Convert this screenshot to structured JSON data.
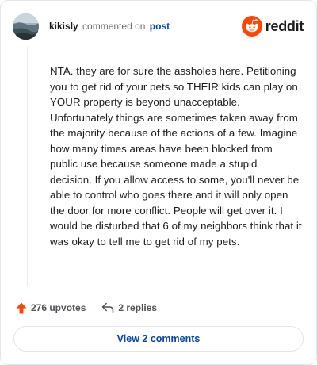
{
  "header": {
    "username": "kikisly",
    "verb": "commented on",
    "post_link": "post",
    "brand": "reddit",
    "logo_icon": "reddit-alien-icon",
    "avatar_icon": "user-avatar-image"
  },
  "comment": {
    "text": "NTA. they are for sure the assholes here. Petitioning you to get rid of your pets so THEIR kids can play on YOUR property is beyond unacceptable. Unfortunately things are sometimes taken away from the majority because of the actions of a few. Imagine how many times areas have been blocked from public use because someone made a stupid decision. If you allow access to some, you'll never be able to control who goes there and it will only open the door for more conflict. People will get over it. I would be disturbed that 6 of my neighbors think that it was okay to tell me to get rid of my pets."
  },
  "actions": {
    "upvotes": "276 upvotes",
    "upvote_icon": "upvote-arrow-icon",
    "replies": "2 replies",
    "reply_icon": "reply-arrow-icon"
  },
  "footer": {
    "view_comments": "View 2 comments"
  },
  "colors": {
    "brand_orange": "#ff4500",
    "link_blue": "#0045ac",
    "text": "#1c1c1c",
    "muted": "#6a6f74"
  }
}
